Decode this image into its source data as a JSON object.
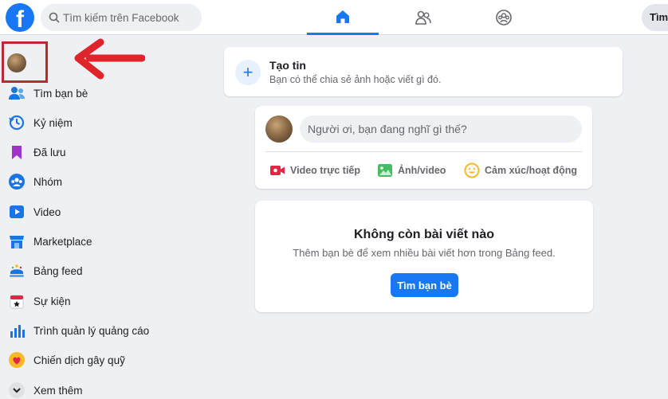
{
  "header": {
    "logo": "f",
    "search_placeholder": "Tìm kiếm trên Facebook",
    "right_button": "Tìm",
    "tabs": [
      {
        "icon": "home-icon",
        "active": true
      },
      {
        "icon": "friends-icon",
        "active": false
      },
      {
        "icon": "groups-icon",
        "active": false
      }
    ]
  },
  "sidebar": {
    "items": [
      {
        "label": "Tìm bạn bè",
        "icon": "friends-icon"
      },
      {
        "label": "Kỷ niệm",
        "icon": "memories-icon"
      },
      {
        "label": "Đã lưu",
        "icon": "saved-icon"
      },
      {
        "label": "Nhóm",
        "icon": "groups-icon"
      },
      {
        "label": "Video",
        "icon": "video-icon"
      },
      {
        "label": "Marketplace",
        "icon": "marketplace-icon"
      },
      {
        "label": "Bảng feed",
        "icon": "feed-icon"
      },
      {
        "label": "Sự kiện",
        "icon": "events-icon"
      },
      {
        "label": "Trình quản lý quảng cáo",
        "icon": "ads-manager-icon"
      },
      {
        "label": "Chiến dịch gây quỹ",
        "icon": "fundraiser-icon"
      },
      {
        "label": "Xem thêm",
        "icon": "chevron-down-icon"
      }
    ]
  },
  "story": {
    "title": "Tạo tin",
    "subtitle": "Bạn có thể chia sẻ ảnh hoặc viết gì đó."
  },
  "composer": {
    "placeholder": "Người ơi, bạn đang nghĩ gì thế?",
    "actions": [
      {
        "label": "Video trực tiếp",
        "icon": "live-video-icon",
        "color": "#e42645"
      },
      {
        "label": "Ảnh/video",
        "icon": "photo-icon",
        "color": "#45bd62"
      },
      {
        "label": "Cảm xúc/hoạt động",
        "icon": "feeling-icon",
        "color": "#f7b928"
      }
    ]
  },
  "empty_feed": {
    "title": "Không còn bài viết nào",
    "subtitle": "Thêm bạn bè để xem nhiều bài viết hơn trong Bảng feed.",
    "button": "Tìm bạn bè"
  },
  "colors": {
    "brand": "#1877f2",
    "highlight_box": "#c0282f",
    "arrow": "#e0242b"
  }
}
